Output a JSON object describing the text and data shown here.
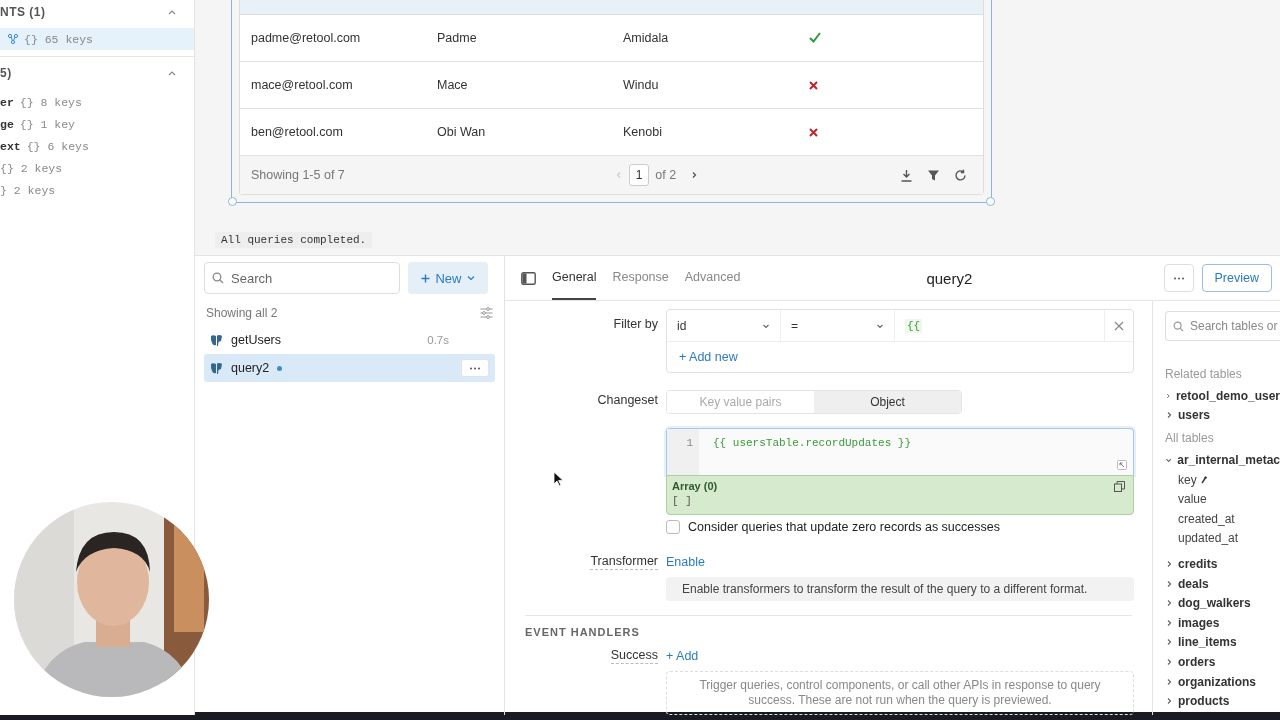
{
  "state_panel": {
    "sections": [
      {
        "title": "NTS (1)",
        "expanded": true,
        "items": [
          {
            "summary": "{} 65 keys",
            "selected": true,
            "kind": "component"
          }
        ]
      },
      {
        "title": "5)",
        "expanded": true,
        "items": [
          {
            "name": "er",
            "summary": "{} 8 keys",
            "selected": false,
            "kind": "object"
          },
          {
            "name": "ge",
            "summary": "{} 1 key",
            "selected": false,
            "kind": "object"
          },
          {
            "name": "ext",
            "summary": "{} 6 keys",
            "selected": false,
            "kind": "object"
          },
          {
            "summary": "{} 2 keys",
            "selected": false,
            "kind": "object"
          },
          {
            "summary": "} 2 keys",
            "selected": false,
            "kind": "object"
          }
        ]
      }
    ]
  },
  "table": {
    "rows": [
      {
        "email": "padme@retool.com",
        "first_name": "Padme",
        "last_name": "Amidala",
        "verified": true
      },
      {
        "email": "mace@retool.com",
        "first_name": "Mace",
        "last_name": "Windu",
        "verified": false
      },
      {
        "email": "ben@retool.com",
        "first_name": "Obi Wan",
        "last_name": "Kenobi",
        "verified": false
      }
    ],
    "footer": {
      "summary": "Showing 1-5 of 7",
      "page": "1",
      "page_count": "of 2"
    }
  },
  "status_bar": {
    "message": "All queries completed."
  },
  "query_list": {
    "search": {
      "placeholder": "Search"
    },
    "new_button": "New",
    "count_label": "Showing all 2",
    "items": [
      {
        "name": "getUsers",
        "time": "0.7s",
        "selected": false,
        "unsaved": false
      },
      {
        "name": "query2",
        "selected": true,
        "unsaved": true
      }
    ]
  },
  "editor": {
    "tabs": [
      {
        "label": "General",
        "selected": true
      },
      {
        "label": "Response",
        "selected": false
      },
      {
        "label": "Advanced",
        "selected": false
      }
    ],
    "title": "query2",
    "preview_button": "Preview",
    "filter": {
      "label": "Filter by",
      "column": "id",
      "operator": "=",
      "value": "{{",
      "add_link": "+ Add new"
    },
    "changeset": {
      "label": "Changeset",
      "options": [
        {
          "label": "Key value pairs",
          "selected": false
        },
        {
          "label": "Object",
          "selected": true
        }
      ],
      "line_number": "1",
      "code": "{{ usersTable.recordUpdates }}",
      "result_title": "Array (0)",
      "result_value": "[ ]"
    },
    "zero_records": {
      "label": "Consider queries that update zero records as successes",
      "checked": false
    },
    "transformer": {
      "label": "Transformer",
      "link": "Enable",
      "hint": "Enable transformers to transform the result of the query to a different format."
    },
    "event_handlers": {
      "heading": "EVENT HANDLERS",
      "label": "Success",
      "link": "+ Add",
      "hint": "Trigger queries, control components, or call other APIs in response to query success. These are not run when the query is previewed."
    }
  },
  "schema_panel": {
    "search": {
      "placeholder": "Search tables or"
    },
    "sections": [
      {
        "title": "Related tables",
        "tables": [
          {
            "name": "retool_demo_user",
            "expanded": false
          },
          {
            "name": "users",
            "expanded": false
          }
        ]
      },
      {
        "title": "All tables",
        "tables": [
          {
            "name": "ar_internal_metac",
            "expanded": true,
            "columns": [
              {
                "name": "key",
                "primary": true
              },
              {
                "name": "value",
                "primary": false
              },
              {
                "name": "created_at",
                "primary": false
              },
              {
                "name": "updated_at",
                "primary": false
              }
            ]
          },
          {
            "name": "credits",
            "expanded": false
          },
          {
            "name": "deals",
            "expanded": false
          },
          {
            "name": "dog_walkers",
            "expanded": false
          },
          {
            "name": "images",
            "expanded": false
          },
          {
            "name": "line_items",
            "expanded": false
          },
          {
            "name": "orders",
            "expanded": false
          },
          {
            "name": "organizations",
            "expanded": false
          },
          {
            "name": "products",
            "expanded": false
          }
        ]
      }
    ]
  }
}
